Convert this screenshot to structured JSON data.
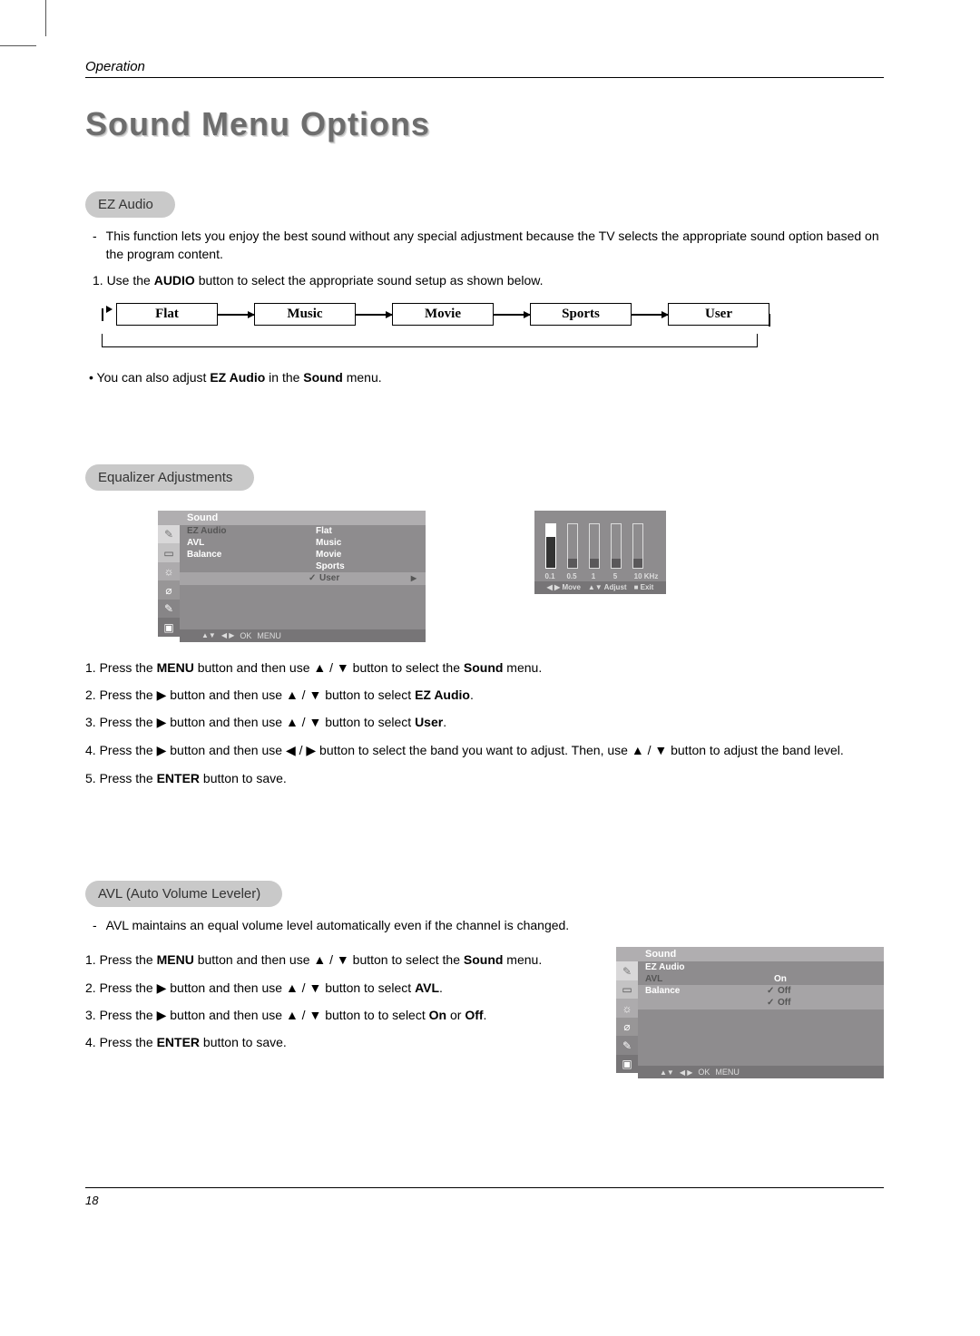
{
  "header": {
    "section": "Operation"
  },
  "title": "Sound Menu Options",
  "ez": {
    "pill": "EZ Audio",
    "desc": "This function lets you enjoy the best sound without any special adjustment because the TV selects the appropriate sound option based on the program content.",
    "step1_a": "1. Use the ",
    "step1_b": "AUDIO",
    "step1_c": " button to select the appropriate sound setup as shown below.",
    "flow": [
      "Flat",
      "Music",
      "Movie",
      "Sports",
      "User"
    ],
    "note_a": "• You can also adjust ",
    "note_b": "EZ Audio",
    "note_c": " in the ",
    "note_d": "Sound",
    "note_e": " menu."
  },
  "eq": {
    "pill": "Equalizer Adjustments",
    "menu": {
      "title": "Sound",
      "items": [
        "EZ Audio",
        "AVL",
        "Balance"
      ],
      "opts": [
        "Flat",
        "Music",
        "Movie",
        "Sports"
      ],
      "selected": "User",
      "footer": {
        "ok": "OK",
        "menu": "MENU"
      }
    },
    "panel": {
      "labels": [
        "0.1",
        "0.5",
        "1",
        "5",
        "10 KHz"
      ],
      "footer": {
        "move": "Move",
        "adjust": "Adjust",
        "exit": "Exit"
      }
    },
    "s1a": "1. Press the ",
    "s1b": "MENU",
    "s1c": " button and then use ",
    "s1d": " button to select the ",
    "s1e": "Sound",
    "s1f": " menu.",
    "s2a": "2. Press the ",
    "s2b": " button and then use ",
    "s2c": " button to select ",
    "s2d": "EZ Audio",
    "s2e": ".",
    "s3a": "3. Press the ",
    "s3b": " button and then use ",
    "s3c": " button to select ",
    "s3d": "User",
    "s3e": ".",
    "s4a": "4. Press the ",
    "s4b": " button and then use ",
    "s4c": " button to select the band you want to adjust. Then, use ",
    "s4d": " button to adjust the band level.",
    "s5a": "5. Press the ",
    "s5b": "ENTER",
    "s5c": " button to save."
  },
  "avl": {
    "pill": "AVL (Auto Volume Leveler)",
    "desc": "AVL maintains an equal volume level automatically even if the channel is changed.",
    "menu": {
      "title": "Sound",
      "items": [
        "EZ Audio",
        "AVL",
        "Balance"
      ],
      "opts": [
        "On"
      ],
      "selected": "Off",
      "footer": {
        "ok": "OK",
        "menu": "MENU"
      }
    },
    "s1a": "1. Press the ",
    "s1b": "MENU",
    "s1c": " button and then use ",
    "s1d": " button to select the ",
    "s1e": "Sound",
    "s1f": " menu.",
    "s2a": "2. Press the ",
    "s2b": " button and then use ",
    "s2c": " button to select ",
    "s2d": "AVL",
    "s2e": ".",
    "s3a": "3. Press the ",
    "s3b": " button and then use ",
    "s3c": " button to to select ",
    "s3d": "On",
    "s3e": " or ",
    "s3f": "Off",
    "s3g": ".",
    "s4a": "4. Press the ",
    "s4b": "ENTER",
    "s4c": " button to save."
  },
  "page_number": "18",
  "glyphs": {
    "up": "▲",
    "down": "▼",
    "left": "◀",
    "right": "▶",
    "stop": "■",
    "slash": " / "
  }
}
